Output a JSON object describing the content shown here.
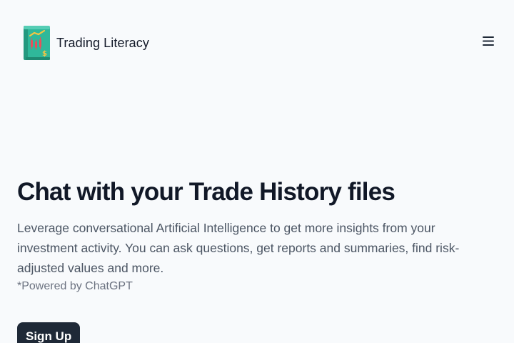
{
  "header": {
    "brand_name": "Trading Literacy",
    "logo_icon": "trading-book-icon",
    "menu_icon": "hamburger-menu-icon"
  },
  "hero": {
    "title": "Chat with your Trade History files",
    "description": "Leverage conversational Artificial Intelligence to get more insights from your investment activity. You can ask questions, get reports and summaries, find risk-adjusted values and more.",
    "powered_by": "*Powered by ChatGPT",
    "signup_label": "Sign Up"
  },
  "colors": {
    "background": "#f8fafc",
    "primary_button": "#1f2937",
    "logo_teal": "#2bb89a"
  }
}
